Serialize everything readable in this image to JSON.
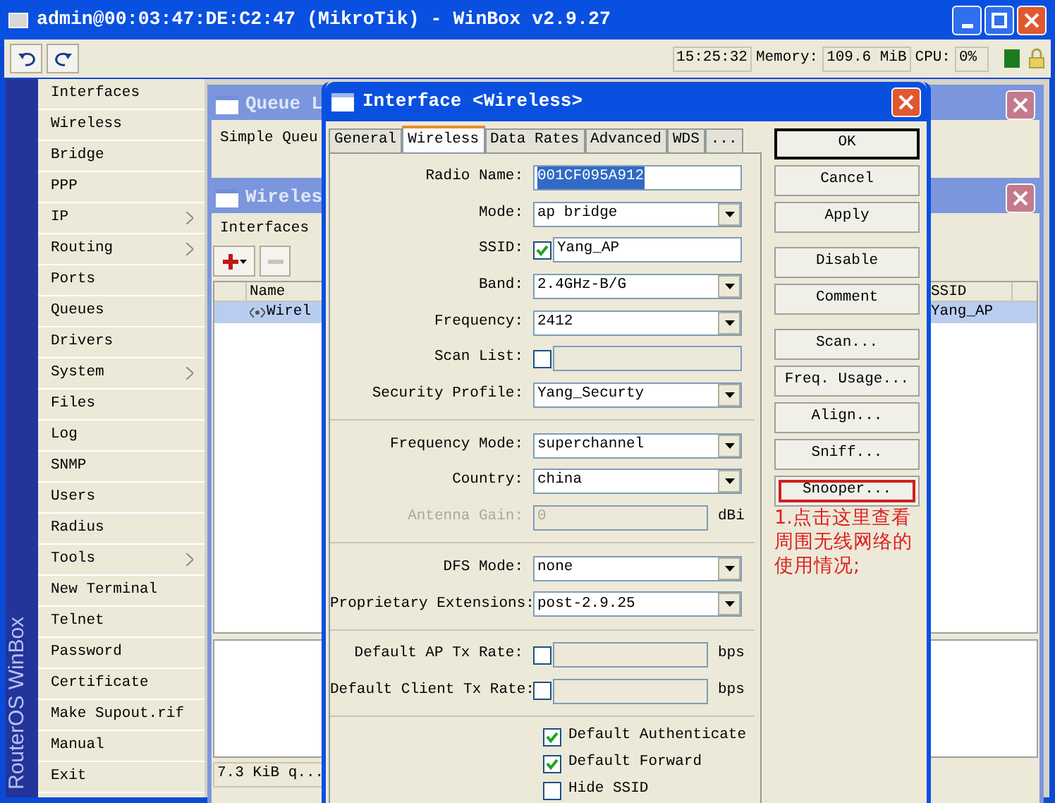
{
  "window": {
    "title": "admin@00:03:47:DE:C2:47 (MikroTik) - WinBox v2.9.27"
  },
  "toolbar": {
    "time": "15:25:32",
    "memory_label": "Memory:",
    "memory": "109.6 MiB",
    "cpu_label": "CPU:",
    "cpu": "0%"
  },
  "side_banner": "RouterOS WinBox",
  "menu": [
    {
      "label": "Interfaces",
      "submenu": false
    },
    {
      "label": "Wireless",
      "submenu": false
    },
    {
      "label": "Bridge",
      "submenu": false
    },
    {
      "label": "PPP",
      "submenu": false
    },
    {
      "label": "IP",
      "submenu": true
    },
    {
      "label": "Routing",
      "submenu": true
    },
    {
      "label": "Ports",
      "submenu": false
    },
    {
      "label": "Queues",
      "submenu": false
    },
    {
      "label": "Drivers",
      "submenu": false
    },
    {
      "label": "System",
      "submenu": true
    },
    {
      "label": "Files",
      "submenu": false
    },
    {
      "label": "Log",
      "submenu": false
    },
    {
      "label": "SNMP",
      "submenu": false
    },
    {
      "label": "Users",
      "submenu": false
    },
    {
      "label": "Radius",
      "submenu": false
    },
    {
      "label": "Tools",
      "submenu": true
    },
    {
      "label": "New Terminal",
      "submenu": false
    },
    {
      "label": "Telnet",
      "submenu": false
    },
    {
      "label": "Password",
      "submenu": false
    },
    {
      "label": "Certificate",
      "submenu": false
    },
    {
      "label": "Make Supout.rif",
      "submenu": false
    },
    {
      "label": "Manual",
      "submenu": false
    },
    {
      "label": "Exit",
      "submenu": false
    }
  ],
  "queue_window": {
    "title": "Queue L",
    "tab": "Simple Queu"
  },
  "wireless_window": {
    "title": "Wireles",
    "tab": "Interfaces",
    "columns": [
      "Name",
      "SSID"
    ],
    "row": {
      "name": "Wirel",
      "ssid": "Yang_AP",
      "selected": true
    },
    "status": "7.3 KiB q..."
  },
  "dialog": {
    "title": "Interface <Wireless>",
    "tabs": [
      {
        "label": "General",
        "selected": false
      },
      {
        "label": "Wireless",
        "selected": true
      },
      {
        "label": "Data Rates",
        "selected": false
      },
      {
        "label": "Advanced",
        "selected": false
      },
      {
        "label": "WDS",
        "selected": false
      },
      {
        "label": "...",
        "selected": false
      }
    ],
    "fields": [
      {
        "kind": "text",
        "label": "Radio Name:",
        "value": "001CF095A912",
        "highlighted": true,
        "disabled": false
      },
      {
        "kind": "dropdown",
        "label": "Mode:",
        "value": "ap bridge"
      },
      {
        "kind": "check_text",
        "label": "SSID:",
        "checked": true,
        "value": "Yang_AP"
      },
      {
        "kind": "dropdown",
        "label": "Band:",
        "value": "2.4GHz-B/G"
      },
      {
        "kind": "dropdown",
        "label": "Frequency:",
        "value": "2412"
      },
      {
        "kind": "check_text",
        "label": "Scan List:",
        "checked": false
      },
      {
        "kind": "dropdown",
        "label": "Security Profile:",
        "value": "Yang_Securty"
      },
      {
        "kind": "separator"
      },
      {
        "kind": "dropdown",
        "label": "Frequency Mode:",
        "value": "superchannel"
      },
      {
        "kind": "dropdown",
        "label": "Country:",
        "value": "china"
      },
      {
        "kind": "text",
        "label": "Antenna Gain:",
        "value": "0",
        "highlighted": false,
        "disabled": true,
        "unit": "dBi"
      },
      {
        "kind": "separator"
      },
      {
        "kind": "dropdown",
        "label": "DFS Mode:",
        "value": "none"
      },
      {
        "kind": "dropdown",
        "label": "Proprietary Extensions:",
        "value": "post-2.9.25"
      },
      {
        "kind": "separator"
      },
      {
        "kind": "check_text",
        "label": "Default AP Tx Rate:",
        "checked": false,
        "unit": "bps"
      },
      {
        "kind": "check_text",
        "label": "Default Client Tx Rate:",
        "checked": false,
        "unit": "bps"
      },
      {
        "kind": "separator"
      },
      {
        "kind": "checkbox",
        "label": "Default Authenticate",
        "checked": true
      },
      {
        "kind": "checkbox",
        "label": "Default Forward",
        "checked": true
      },
      {
        "kind": "checkbox",
        "label": "Hide SSID",
        "checked": false
      }
    ],
    "button_groups": [
      [
        {
          "label": "OK",
          "default": true,
          "annotated": false
        },
        {
          "label": "Cancel",
          "default": false,
          "annotated": false
        },
        {
          "label": "Apply",
          "default": false,
          "annotated": false
        }
      ],
      [
        {
          "label": "Disable",
          "default": false,
          "annotated": false
        },
        {
          "label": "Comment",
          "default": false,
          "annotated": false
        }
      ],
      [
        {
          "label": "Scan...",
          "default": false,
          "annotated": false
        },
        {
          "label": "Freq. Usage...",
          "default": false,
          "annotated": false
        },
        {
          "label": "Align...",
          "default": false,
          "annotated": false
        },
        {
          "label": "Sniff...",
          "default": false,
          "annotated": false
        },
        {
          "label": "Snooper...",
          "default": false,
          "annotated": true
        }
      ]
    ],
    "annotation": "1.点击这里查看周围无线网络的使用情况;"
  }
}
